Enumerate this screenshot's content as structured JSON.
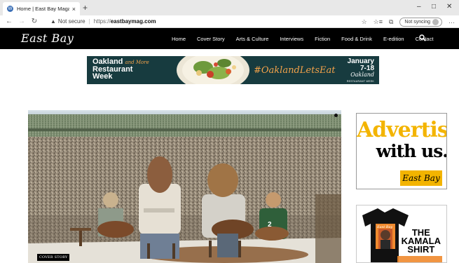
{
  "browser": {
    "tab_title": "Home | East Bay Magazine",
    "tab_close": "×",
    "new_tab": "+",
    "security": "Not secure",
    "url_protocol": "https://",
    "url_host": "eastbaymag.com",
    "sync_label": "Not syncing",
    "icons": [
      "back-arrow-icon",
      "forward-arrow-icon",
      "refresh-icon",
      "warning-icon",
      "star-icon",
      "favorites-icon",
      "collections-icon",
      "menu-icon"
    ],
    "window_controls": [
      "–",
      "□",
      "✕"
    ]
  },
  "site": {
    "logo": "East Bay",
    "nav": [
      "Home",
      "Cover Story",
      "Arts & Culture",
      "Interviews",
      "Fiction",
      "Food & Drink",
      "E-edition",
      "Contact"
    ],
    "colors": {
      "header_bg": "#000000",
      "accent": "#f3b400",
      "banner_bg": "#173b3f",
      "banner_accent": "#f3a24a"
    }
  },
  "banner": {
    "line1": "Oakland",
    "and_more": "and More",
    "line2": "Restaurant",
    "line3": "Week",
    "hashtag": "#OaklandLetsEat",
    "date_month": "January",
    "date_range": "7-18",
    "brand": "Oakland",
    "brand_sub": "RESTAURANT WEEK"
  },
  "hero": {
    "badge": "COVER STORY"
  },
  "sidebar": {
    "ad1_line1": "Advertise",
    "ad1_line2": "with us.",
    "ad1_brand": "East Bay",
    "ad2_word1": "THE",
    "ad2_word2": "KAMALA",
    "ad2_word3": "SHIRT",
    "ad2_shirt_label": "East Bay"
  }
}
